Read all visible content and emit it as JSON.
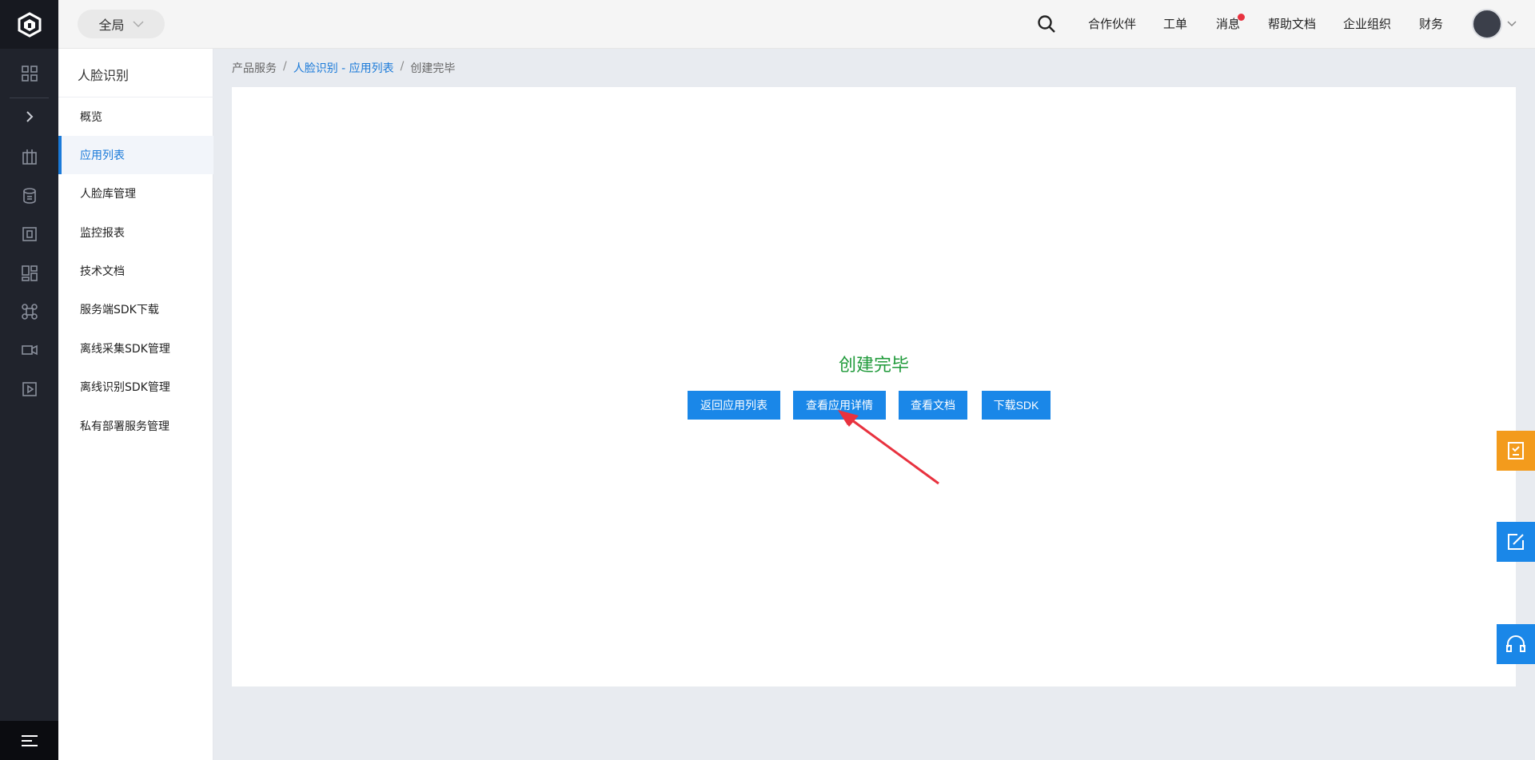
{
  "header": {
    "scope_label": "全局",
    "nav": {
      "partners": "合作伙伴",
      "tickets": "工单",
      "messages": "消息",
      "help_docs": "帮助文档",
      "enterprise": "企业组织",
      "finance": "财务"
    }
  },
  "subnav": {
    "title": "人脸识别",
    "items": [
      {
        "label": "概览"
      },
      {
        "label": "应用列表"
      },
      {
        "label": "人脸库管理"
      },
      {
        "label": "监控报表"
      },
      {
        "label": "技术文档"
      },
      {
        "label": "服务端SDK下载"
      },
      {
        "label": "离线采集SDK管理"
      },
      {
        "label": "离线识别SDK管理"
      },
      {
        "label": "私有部署服务管理"
      }
    ]
  },
  "breadcrumb": {
    "root": "产品服务",
    "sep": "/",
    "parent": "人脸识别 - 应用列表",
    "current": "创建完毕"
  },
  "main": {
    "status_title": "创建完毕",
    "buttons": {
      "back_to_list": "返回应用列表",
      "view_detail": "查看应用详情",
      "view_docs": "查看文档",
      "download_sdk": "下载SDK"
    }
  },
  "colors": {
    "accent": "#1a87e8",
    "success": "#1f9a3a",
    "rail": "#20232c",
    "float_orange": "#f39b1c"
  }
}
